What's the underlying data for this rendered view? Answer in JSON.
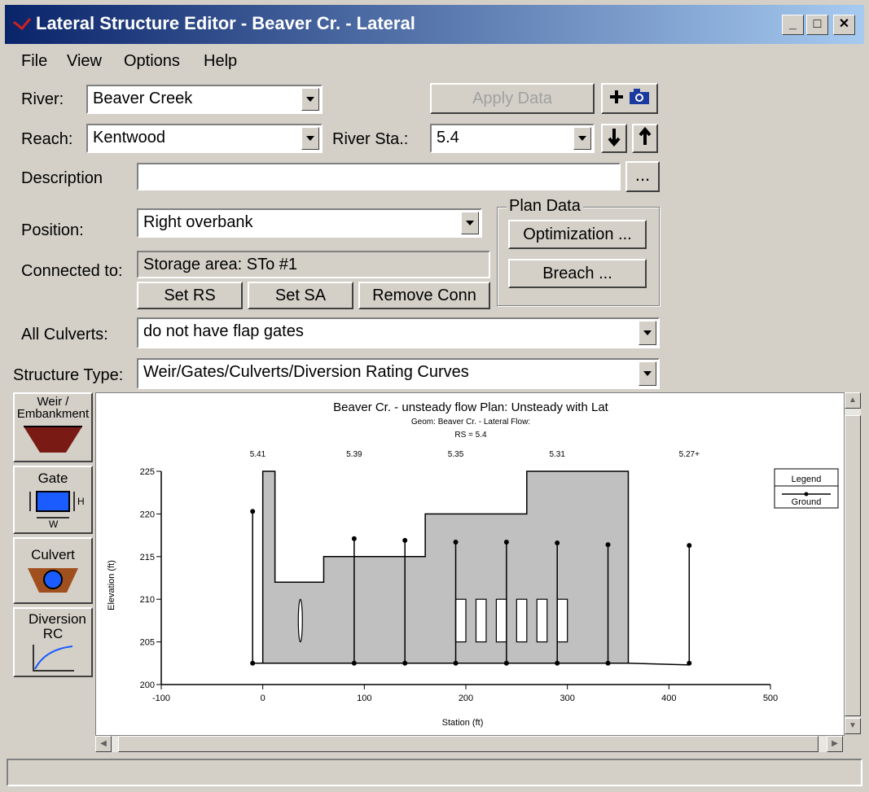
{
  "window": {
    "title": "Lateral Structure Editor - Beaver Cr.  - Lateral",
    "min": "_",
    "max": "□",
    "close": "✕"
  },
  "menu": [
    "File",
    "View",
    "Options",
    "Help"
  ],
  "form": {
    "river_label": "River:",
    "river_value": "Beaver Creek",
    "apply_label": "Apply Data",
    "reach_label": "Reach:",
    "reach_value": "Kentwood",
    "riversta_label": "River Sta.:",
    "riversta_value": "5.4",
    "desc_label": "Description",
    "desc_value": "",
    "desc_btn": "...",
    "position_label": "Position:",
    "position_value": "Right overbank",
    "connected_label": "Connected to:",
    "connected_value": "Storage area: STo #1",
    "set_rs": "Set RS",
    "set_sa": "Set SA",
    "remove_conn": "Remove Conn",
    "plan_data": "Plan Data",
    "optimization": "Optimization ...",
    "breach": "Breach ...",
    "culverts_label": "All Culverts:",
    "culverts_value": "do not have flap gates",
    "structtype_label": "Structure Type:",
    "structtype_value": "Weir/Gates/Culverts/Diversion Rating Curves"
  },
  "side_tabs": [
    {
      "label": "Weir / Embankment"
    },
    {
      "label": "Gate"
    },
    {
      "label": "Culvert"
    },
    {
      "label": "Diversion RC"
    }
  ],
  "gate_dims": {
    "h": "H",
    "w": "W"
  },
  "chart_data": {
    "type": "area",
    "title": "Beaver Cr. - unsteady flow      Plan: Unsteady with Lat",
    "subtitle": "Geom: Beaver Cr. - Lateral    Flow:",
    "rs_label": "RS = 5.4",
    "xlabel": "Station (ft)",
    "ylabel": "Elevation (ft)",
    "xlim": [
      -100,
      500
    ],
    "ylim": [
      200,
      225
    ],
    "xticks": [
      -100,
      0,
      100,
      200,
      300,
      400,
      500
    ],
    "yticks": [
      200,
      205,
      210,
      215,
      220,
      225
    ],
    "xs_labels": [
      {
        "x": -5,
        "label": "5.41"
      },
      {
        "x": 90,
        "label": "5.39"
      },
      {
        "x": 190,
        "label": "5.35"
      },
      {
        "x": 290,
        "label": "5.31"
      },
      {
        "x": 420,
        "label": "5.27+"
      }
    ],
    "weir_profile": [
      [
        0,
        202.5
      ],
      [
        0,
        225
      ],
      [
        12,
        225
      ],
      [
        12,
        212
      ],
      [
        40,
        212
      ],
      [
        40,
        212
      ],
      [
        60,
        212
      ],
      [
        60,
        215
      ],
      [
        160,
        215
      ],
      [
        160,
        220
      ],
      [
        260,
        220
      ],
      [
        260,
        225
      ],
      [
        360,
        225
      ],
      [
        360,
        202.5
      ],
      [
        0,
        202.5
      ]
    ],
    "ground": [
      [
        -10,
        202.5
      ],
      [
        90,
        202.5
      ],
      [
        140,
        202.5
      ],
      [
        190,
        202.5
      ],
      [
        240,
        202.5
      ],
      [
        290,
        202.5
      ],
      [
        340,
        202.5
      ],
      [
        360,
        202.5
      ],
      [
        420,
        202.3
      ]
    ],
    "xs_lines": [
      {
        "x": -10,
        "top": 220.3
      },
      {
        "x": 90,
        "top": 217.1
      },
      {
        "x": 140,
        "top": 216.9
      },
      {
        "x": 190,
        "top": 216.7
      },
      {
        "x": 240,
        "top": 216.7
      },
      {
        "x": 290,
        "top": 216.6
      },
      {
        "x": 340,
        "top": 216.4
      },
      {
        "x": 420,
        "top": 216.3
      }
    ],
    "culvert_circle": {
      "x": 37,
      "y": 207.5,
      "w": 4,
      "h": 5
    },
    "culvert_boxes": [
      [
        195,
        205
      ],
      [
        215,
        205
      ],
      [
        235,
        205
      ],
      [
        255,
        205
      ],
      [
        275,
        205
      ],
      [
        295,
        205
      ]
    ],
    "culvert_box_size": {
      "w": 10,
      "h": 5
    },
    "legend": {
      "title": "Legend",
      "items": [
        "Ground"
      ]
    }
  }
}
